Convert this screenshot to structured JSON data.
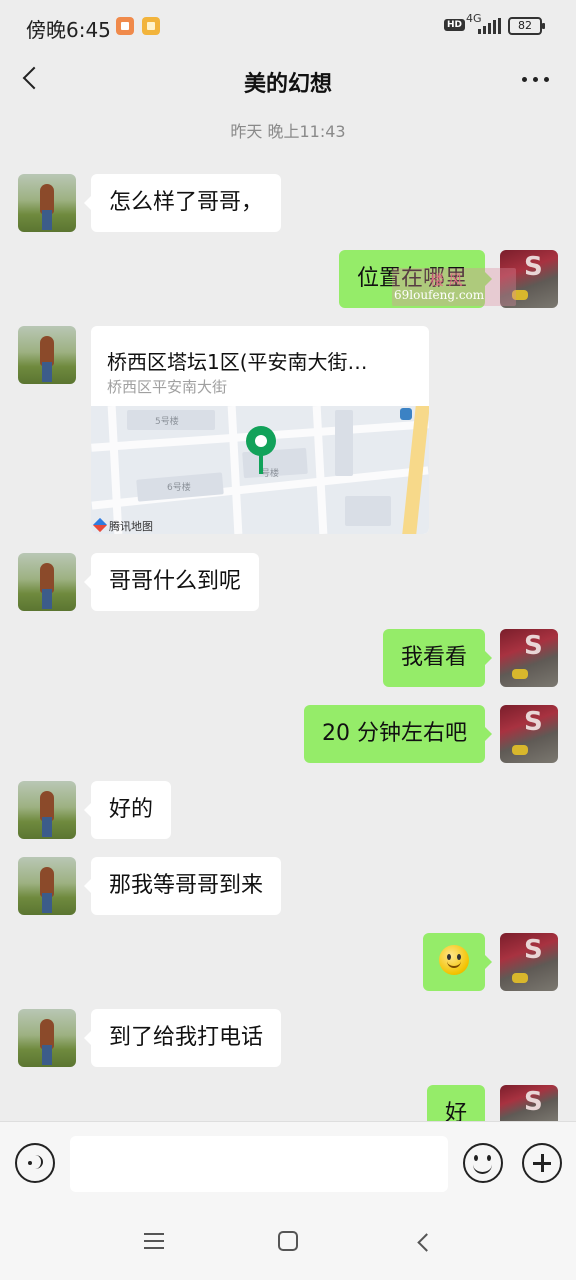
{
  "status_bar": {
    "time": "傍晚6:45",
    "network": "4G",
    "hd": "HD",
    "battery": "82",
    "app_icons": [
      "app-notification-icon",
      "app-notification-icon"
    ]
  },
  "header": {
    "title": "美的幻想",
    "back_icon": "back-arrow-icon",
    "more_icon": "more-dots-icon"
  },
  "chat": {
    "timestamp": "昨天 晚上11:43",
    "messages": [
      {
        "side": "in",
        "type": "text",
        "text": "怎么样了哥哥，"
      },
      {
        "side": "out",
        "type": "text",
        "text": "位置在哪里"
      },
      {
        "side": "in",
        "type": "location",
        "title": "桥西区塔坛1区(平安南大街…",
        "subtitle": "桥西区平安南大街",
        "map_labels": [
          "5号楼",
          "6号楼",
          "号楼"
        ],
        "map_brand": "腾讯地图"
      },
      {
        "side": "in",
        "type": "text",
        "text": "哥哥什么到呢"
      },
      {
        "side": "out",
        "type": "text",
        "text": "我看看"
      },
      {
        "side": "out",
        "type": "text",
        "text": "20 分钟左右吧"
      },
      {
        "side": "in",
        "type": "text",
        "text": "好的"
      },
      {
        "side": "in",
        "type": "text",
        "text": "那我等哥哥到来"
      },
      {
        "side": "out",
        "type": "emoji",
        "icon": "smiley-emoji-icon"
      },
      {
        "side": "in",
        "type": "text",
        "text": "到了给我打电话"
      },
      {
        "side": "out",
        "type": "text",
        "text": "好"
      }
    ],
    "watermark": {
      "line1": "楼 风",
      "line2": "69loufeng.com"
    }
  },
  "input_bar": {
    "value": "",
    "placeholder": "",
    "voice_icon": "voice-icon",
    "emoji_icon": "emoji-icon",
    "plus_icon": "plus-icon"
  },
  "system_nav": [
    "menu-icon",
    "home-icon",
    "back-icon"
  ],
  "colors": {
    "background": "#ededed",
    "bubble_out": "#95ec69",
    "bubble_in": "#ffffff",
    "pin": "#12a25a"
  }
}
